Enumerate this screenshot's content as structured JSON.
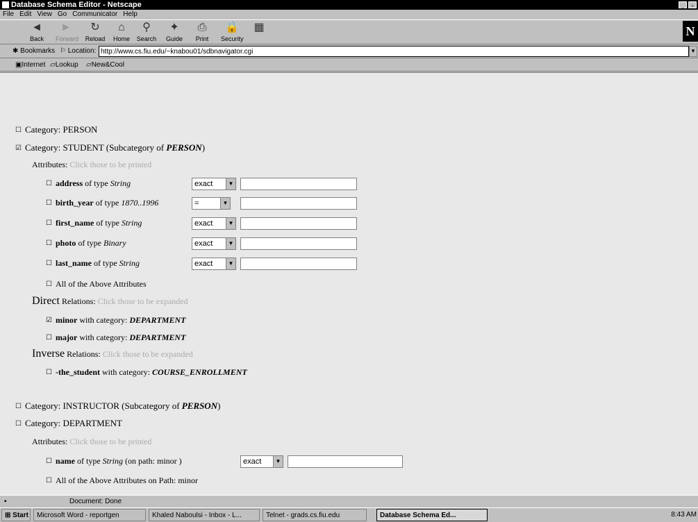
{
  "window": {
    "title": "Database Schema Editor - Netscape"
  },
  "menu": [
    "File",
    "Edit",
    "View",
    "Go",
    "Communicator",
    "Help"
  ],
  "toolbar": {
    "buttons": [
      {
        "label": "Back"
      },
      {
        "label": "Forward"
      },
      {
        "label": "Reload"
      },
      {
        "label": "Home"
      },
      {
        "label": "Search"
      },
      {
        "label": "Guide"
      },
      {
        "label": "Print"
      },
      {
        "label": "Security"
      },
      {
        "label": ""
      }
    ]
  },
  "location": {
    "bookmarks_label": "Bookmarks",
    "location_label": "Location:",
    "url": "http://www.cs.fiu.edu/~knabou01/sdbnavigator.cgi"
  },
  "links": [
    "Internet",
    "Lookup",
    "New&Cool"
  ],
  "content": {
    "cat1": {
      "checked": "☐",
      "prefix": "Category:",
      "name": "PERSON"
    },
    "cat2": {
      "checked": "☑",
      "prefix": "Category:",
      "name": "STUDENT",
      "sub_prefix": "(Subcategory of",
      "sub_name": "PERSON",
      "sub_suffix": ")"
    },
    "attr_header": {
      "label": "Attributes:",
      "hint": "Click those to be printed"
    },
    "attrs": [
      {
        "name": "address",
        "of_type": "of type",
        "type": "String",
        "select": "exact"
      },
      {
        "name": "birth_year",
        "of_type": "of type",
        "type": "1870..1996",
        "select": "="
      },
      {
        "name": "first_name",
        "of_type": "of type",
        "type": "String",
        "select": "exact"
      },
      {
        "name": "photo",
        "of_type": "of type",
        "type": "Binary",
        "select": "exact"
      },
      {
        "name": "last_name",
        "of_type": "of type",
        "type": "String",
        "select": "exact"
      }
    ],
    "all_attrs": "All of the Above Attributes",
    "direct": {
      "big": "Direct",
      "small": "Relations:",
      "hint": "Click those to be expanded"
    },
    "direct_rels": [
      {
        "checked": "☑",
        "name": "minor",
        "with": "with category:",
        "target": "DEPARTMENT"
      },
      {
        "checked": "☐",
        "name": "major",
        "with": "with category:",
        "target": "DEPARTMENT"
      }
    ],
    "inverse": {
      "big": "Inverse",
      "small": "Relations:",
      "hint": "Click those to be expanded"
    },
    "inverse_rels": [
      {
        "checked": "☐",
        "name": "-the_student",
        "with": "with category:",
        "target": "COURSE_ENROLLMENT"
      }
    ],
    "cat3": {
      "checked": "☐",
      "prefix": "Category:",
      "name": "INSTRUCTOR",
      "sub_prefix": "(Subcategory of",
      "sub_name": "PERSON",
      "sub_suffix": ")"
    },
    "cat4": {
      "checked": "☐",
      "prefix": "Category:",
      "name": "DEPARTMENT"
    },
    "attr_header2": {
      "label": "Attributes:",
      "hint": "Click those to be printed"
    },
    "dept_attr": {
      "name": "name",
      "of_type": "of type",
      "type": "String",
      "path": "(on path: minor )",
      "select": "exact"
    },
    "all_attrs_path": "All of the Above Attributes on Path: minor"
  },
  "status": {
    "text": "Document: Done"
  },
  "taskbar": {
    "start": "Start",
    "tasks": [
      {
        "label": "Microsoft Word - reportgen"
      },
      {
        "label": "Khaled Naboulsi - Inbox - L..."
      },
      {
        "label": "Telnet - grads.cs.fiu.edu"
      },
      {
        "label": "Database Schema Ed..."
      }
    ],
    "clock": "8:43 AM"
  }
}
